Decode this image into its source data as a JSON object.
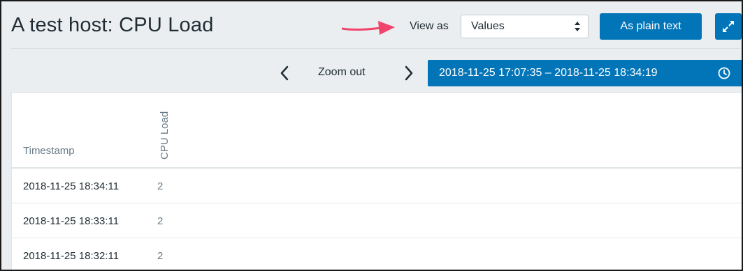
{
  "header": {
    "title": "A test host: CPU Load",
    "view_as_label": "View as",
    "view_as_value": "Values",
    "plain_text_button": "As plain text"
  },
  "timeline": {
    "zoom_out_label": "Zoom out",
    "range": "2018-11-25 17:07:35 – 2018-11-25 18:34:19"
  },
  "table": {
    "columns": [
      "Timestamp",
      "CPU Load"
    ],
    "rows": [
      {
        "timestamp": "2018-11-25 18:34:11",
        "value": "2"
      },
      {
        "timestamp": "2018-11-25 18:33:11",
        "value": "2"
      },
      {
        "timestamp": "2018-11-25 18:32:11",
        "value": "2"
      }
    ]
  },
  "colors": {
    "accent": "#0275b8",
    "annotation_arrow": "#f0446c",
    "background": "#ebeef0"
  },
  "icons": {
    "arrow": "annotation-arrow-icon",
    "select_caret": "updown-caret-icon",
    "fullscreen": "expand-icon",
    "prev": "chevron-left-icon",
    "next": "chevron-right-icon",
    "clock": "clock-icon"
  }
}
